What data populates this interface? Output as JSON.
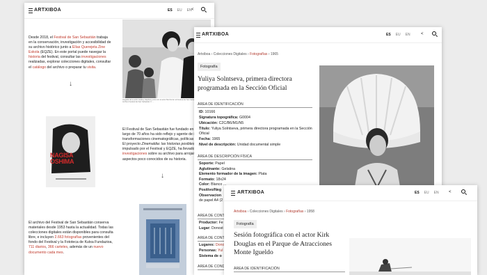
{
  "app": {
    "logo": "ARTXIBOA",
    "langs": [
      "ES",
      "EU",
      "EN"
    ]
  },
  "left_page": {
    "p1": {
      "a": "Desde 2018, el ",
      "b": "Festival de San Sebastián",
      "c": " trabaja en la conservación, investigación y accesibilidad de su archivo histórico junto a ",
      "d": "Elías Querejeta Zine Eskola",
      "e": " (EQZE). En este portal puede navegar la ",
      "f": "historia",
      "g": " del festival, consultar las ",
      "h": "investigaciones",
      "i": " realizadas, explorar colecciones digitales, consultar el ",
      "j": "catálogo",
      "k": " del archivo o preparar tu ",
      "l": "visita",
      "m": "."
    },
    "photo_caption": "Llegada de la actriz Audrey Hepburn junto con el actor Mel Ferrer al Festival de San Sebastián. Fotografía Archivo Festival de San Sebastián © ...",
    "p2": {
      "a": "El Festival de San Sebastián fue fundado en 1953. A lo largo de 70 años ha sido reflejo y agente de importantes transformaciones cinematográficas, políticas y sociales. El proyecto ",
      "b": "Zinemaldia: las historias posibles",
      "c": ", impulsado por el Festival y EQZE, ha llevado a cabo ",
      "d": "investigaciones",
      "e": " sobre su archivo para arrojar luz sobre aspectos poco conocidos de su historia."
    },
    "poster_text": "NAGISA OSHIMA",
    "p3": {
      "a": "El archivo del Festival de San Sebastián conserva materiales desde 1953 hasta la actualidad. Todas las colecciones digitales están disponibles para consulta libre, e incluyen ",
      "b": "2.663 fotografías",
      "c": " provenientes del fondo del Festival y la Fototeca de Kutxa Fundazioa, ",
      "d": "711 diarios",
      "e": ", ",
      "f": "366 carteles",
      "g": ", además de un ",
      "h": "nuevo documento cada mes",
      "i": "."
    }
  },
  "middle_page": {
    "breadcrumb": [
      "Artxiboa",
      "Colecciones Digitales",
      "Fotografías",
      "1965"
    ],
    "badge": "Fotografía",
    "title": "Yuliya Solntseva, primera directora programada en la Sección Oficial",
    "sections": {
      "identification": "ÁREA DE IDENTIFICACIÓN",
      "physical": "ÁREA DE DESCRIPCIÓN FÍSICA",
      "content": "ÁREA DE CONTENIDO",
      "context": "ÁREA DE CONTEXTO",
      "conditions": "ÁREA DE CONDICIONES"
    },
    "identification_fields": [
      {
        "label": "ID:",
        "value": "10166"
      },
      {
        "label": "Signatura topográfica:",
        "value": "G0004"
      },
      {
        "label": "Ubicación:",
        "value": "C2C/B6/M1/N5"
      },
      {
        "label": "Título:",
        "value": "Yuliya Solntseva, primera directora programada en la Sección Oficial"
      },
      {
        "label": "Fecha:",
        "value": "1965"
      },
      {
        "label": "Nivel de descripción:",
        "value": "Unidad documental simple"
      }
    ],
    "physical_fields": [
      {
        "label": "Soporte:",
        "value": "Papel"
      },
      {
        "label": "Aglutinante:",
        "value": "Gelatina"
      },
      {
        "label": "Elemento formador de la imagen:",
        "value": "Plata"
      },
      {
        "label": "Formato:",
        "value": "18x24"
      },
      {
        "label": "Color:",
        "value": "Blanco ..."
      },
      {
        "label": "Positivo/Neg",
        "value": ""
      },
      {
        "label": "Observacion",
        "value": ""
      },
      {
        "label": "",
        "value": "de papel A4 (2"
      }
    ],
    "context_fields": [
      {
        "label": "Productor:",
        "value": "Fe"
      },
      {
        "label": "Lugar:",
        "value": "Donost"
      }
    ],
    "content_fields": [
      {
        "label": "Lugares:",
        "value": "Dono"
      },
      {
        "label": "Personas:",
        "value": "Yul"
      },
      {
        "label": "Sistema de o",
        "value": ""
      }
    ]
  },
  "front_page": {
    "breadcrumb": [
      "Artxiboa",
      "Colecciones Digitales",
      "Fotografías",
      "1958"
    ],
    "badge": "Fotografía",
    "title": "Sesión fotográfica con el actor Kirk Douglas en el Parque de Atracciones Monte Igueldo",
    "section": "ÁREA DE IDENTIFICACIÓN"
  }
}
